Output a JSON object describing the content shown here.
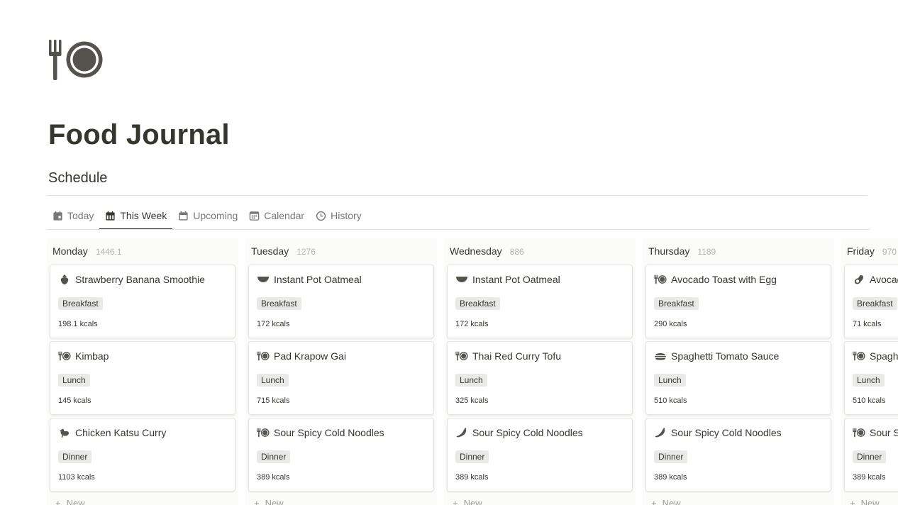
{
  "page": {
    "icon": "fork-plate-icon",
    "title": "Food Journal",
    "section": "Schedule"
  },
  "tabs": [
    {
      "label": "Today",
      "icon": "calendar-day-icon",
      "active": false
    },
    {
      "label": "This Week",
      "icon": "calendar-week-icon",
      "active": true
    },
    {
      "label": "Upcoming",
      "icon": "calendar-icon",
      "active": false
    },
    {
      "label": "Calendar",
      "icon": "calendar-grid-icon",
      "active": false
    },
    {
      "label": "History",
      "icon": "clock-icon",
      "active": false
    }
  ],
  "columns": [
    {
      "day": "Monday",
      "total": "1446.1",
      "new_label": "New",
      "cards": [
        {
          "name": "Strawberry Banana Smoothie",
          "icon": "strawberry-icon",
          "meal": "Breakfast",
          "kcals": "198.1 kcals"
        },
        {
          "name": "Kimbap",
          "icon": "fork-plate-icon",
          "meal": "Lunch",
          "kcals": "145 kcals"
        },
        {
          "name": "Chicken Katsu Curry",
          "icon": "chicken-icon",
          "meal": "Dinner",
          "kcals": "1103 kcals"
        }
      ]
    },
    {
      "day": "Tuesday",
      "total": "1276",
      "new_label": "New",
      "cards": [
        {
          "name": "Instant Pot Oatmeal",
          "icon": "bowl-icon",
          "meal": "Breakfast",
          "kcals": "172 kcals"
        },
        {
          "name": "Pad Krapow Gai",
          "icon": "fork-plate-icon",
          "meal": "Lunch",
          "kcals": "715 kcals"
        },
        {
          "name": "Sour Spicy Cold Noodles",
          "icon": "fork-plate-icon",
          "meal": "Dinner",
          "kcals": "389 kcals"
        }
      ]
    },
    {
      "day": "Wednesday",
      "total": "886",
      "new_label": "New",
      "cards": [
        {
          "name": "Instant Pot Oatmeal",
          "icon": "bowl-icon",
          "meal": "Breakfast",
          "kcals": "172 kcals"
        },
        {
          "name": "Thai Red Curry Tofu",
          "icon": "fork-plate-icon",
          "meal": "Lunch",
          "kcals": "325 kcals"
        },
        {
          "name": "Sour Spicy Cold Noodles",
          "icon": "chili-pepper-icon",
          "meal": "Dinner",
          "kcals": "389 kcals"
        }
      ]
    },
    {
      "day": "Thursday",
      "total": "1189",
      "new_label": "New",
      "cards": [
        {
          "name": "Avocado Toast with Egg",
          "icon": "fork-plate-icon",
          "meal": "Breakfast",
          "kcals": "290 kcals"
        },
        {
          "name": "Spaghetti Tomato Sauce",
          "icon": "burger-icon",
          "meal": "Lunch",
          "kcals": "510 kcals"
        },
        {
          "name": "Sour Spicy Cold Noodles",
          "icon": "chili-pepper-icon",
          "meal": "Dinner",
          "kcals": "389 kcals"
        }
      ]
    },
    {
      "day": "Friday",
      "total": "970",
      "new_label": "New",
      "cards": [
        {
          "name": "Avocado",
          "icon": "avocado-icon",
          "meal": "Breakfast",
          "kcals": "71 kcals"
        },
        {
          "name": "Spaghe",
          "icon": "fork-plate-icon",
          "meal": "Lunch",
          "kcals": "510 kcals"
        },
        {
          "name": "Sour S",
          "icon": "fork-plate-icon",
          "meal": "Dinner",
          "kcals": "389 kcals"
        }
      ]
    }
  ]
}
